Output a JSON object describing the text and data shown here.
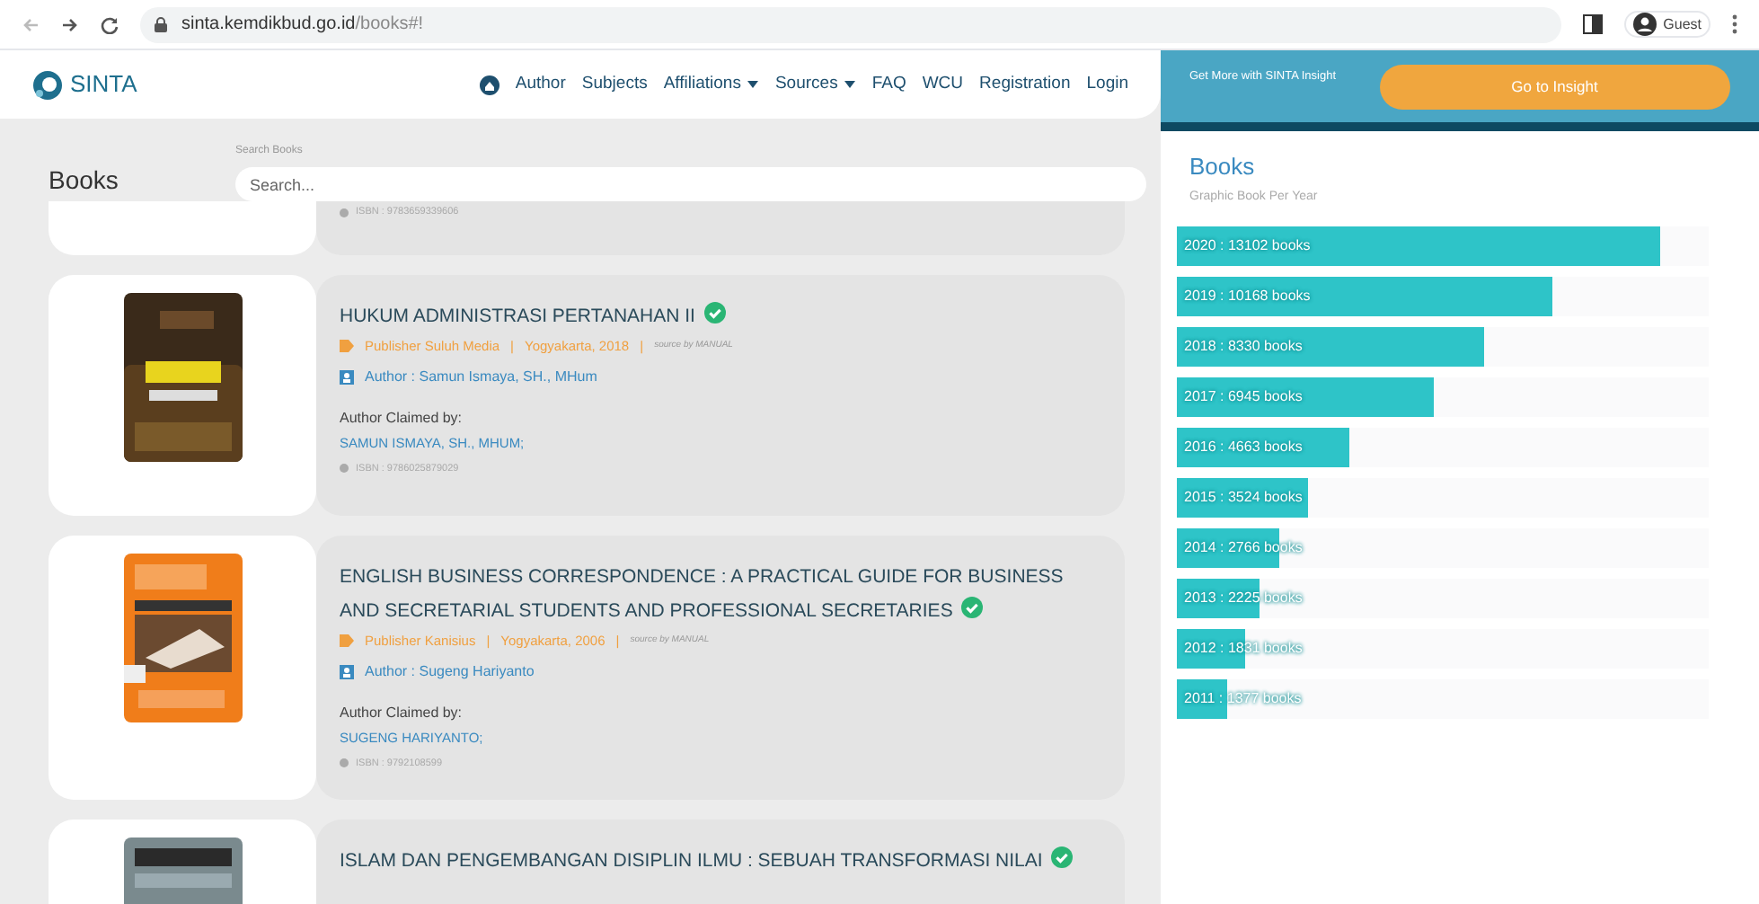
{
  "browser": {
    "url_host": "sinta.kemdikbud.go.id",
    "url_path": "/books#!",
    "profile": "Guest"
  },
  "nav": {
    "brand": "SINTA",
    "items": [
      {
        "label": "Author",
        "dropdown": false
      },
      {
        "label": "Subjects",
        "dropdown": false
      },
      {
        "label": "Affiliations",
        "dropdown": true
      },
      {
        "label": "Sources",
        "dropdown": true
      },
      {
        "label": "FAQ",
        "dropdown": false
      },
      {
        "label": "WCU",
        "dropdown": false
      },
      {
        "label": "Registration",
        "dropdown": false
      },
      {
        "label": "Login",
        "dropdown": false
      }
    ]
  },
  "page_title": "Books",
  "search": {
    "label": "Search Books",
    "placeholder": "Search..."
  },
  "books": [
    {
      "partial": true,
      "isbn": "ISBN : 9783659339606"
    },
    {
      "partial": false,
      "title": "HUKUM ADMINISTRASI PERTANAHAN II",
      "verified": true,
      "publisher": "Publisher Suluh Media",
      "separator_1": "|",
      "place_year": "Yogyakarta, 2018",
      "separator_2": "|",
      "source": "source by MANUAL",
      "author": "Author : Samun Ismaya, SH., MHum",
      "claimed_label": "Author Claimed by:",
      "claimed_by": "SAMUN ISMAYA, SH., MHUM;",
      "isbn": "ISBN : 9786025879029"
    },
    {
      "partial": false,
      "title": "ENGLISH BUSINESS CORRESPONDENCE : A PRACTICAL GUIDE FOR BUSINESS AND SECRETARIAL STUDENTS AND PROFESSIONAL SECRETARIES",
      "verified": true,
      "publisher": "Publisher Kanisius",
      "separator_1": "|",
      "place_year": "Yogyakarta, 2006",
      "separator_2": "|",
      "source": "source by MANUAL",
      "author": "Author : Sugeng Hariyanto",
      "claimed_label": "Author Claimed by:",
      "claimed_by": "SUGENG HARIYANTO;",
      "isbn": "ISBN : 9792108599"
    },
    {
      "partial": false,
      "title": "ISLAM DAN PENGEMBANGAN DISIPLIN ILMU : SEBUAH TRANSFORMASI NILAI",
      "verified": true
    }
  ],
  "insight": {
    "text": "Get More with SINTA Insight",
    "button": "Go to Insight"
  },
  "panel": {
    "title": "Books",
    "subtitle": "Graphic Book Per Year",
    "bars": [
      {
        "label": "2020 : 13102 books",
        "level": 0.91
      },
      {
        "label": "2019 : 10168 books",
        "level": 0.706
      },
      {
        "label": "2018 : 8330 books",
        "level": 0.579
      },
      {
        "label": "2017 : 6945 books",
        "level": 0.482
      },
      {
        "label": "2016 : 4663 books",
        "level": 0.324
      },
      {
        "label": "2015 : 3524 books",
        "level": 0.245
      },
      {
        "label": "2014 : 2766 books",
        "level": 0.192
      },
      {
        "label": "2013 : 2225 books",
        "level": 0.155
      },
      {
        "label": "2012 : 1831 books",
        "level": 0.127
      },
      {
        "label": "2011 : 1377 books",
        "level": 0.096
      }
    ]
  }
}
